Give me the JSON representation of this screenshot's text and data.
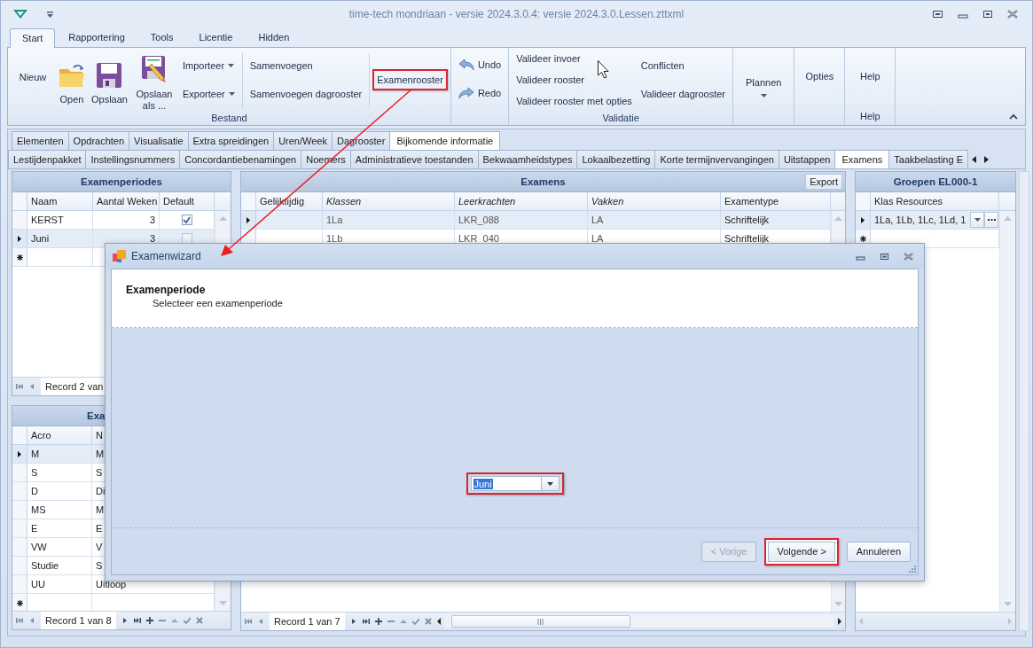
{
  "window": {
    "title": "time-tech mondriaan - versie 2024.3.0.4: versie 2024.3.0.Lessen.zttxml"
  },
  "ribbon_tabs": [
    {
      "label": "Start",
      "selected": true
    },
    {
      "label": "Rapportering",
      "selected": false
    },
    {
      "label": "Tools",
      "selected": false
    },
    {
      "label": "Licentie",
      "selected": false
    },
    {
      "label": "Hidden",
      "selected": false
    }
  ],
  "ribbon_groups": [
    {
      "label": "Bestand",
      "columns": [
        {
          "kind": "large",
          "items": [
            {
              "kind": "text",
              "label": "Nieuw",
              "highlighted": false
            }
          ]
        },
        {
          "kind": "large",
          "items": [
            {
              "kind": "folder",
              "label": "Open",
              "highlighted": false
            }
          ]
        },
        {
          "kind": "large",
          "items": [
            {
              "kind": "floppy",
              "label": "Opslaan",
              "highlighted": false
            }
          ]
        },
        {
          "kind": "large",
          "items": [
            {
              "kind": "floppyedit",
              "label": "Opslaan als ...",
              "highlighted": false
            }
          ]
        },
        {
          "kind": "small",
          "items": [
            {
              "kind": "dropdown",
              "label": "Importeer",
              "highlighted": false
            },
            {
              "kind": "dropdown",
              "label": "Exporteer",
              "highlighted": false
            }
          ]
        },
        {
          "kind": "divider"
        },
        {
          "kind": "small",
          "items": [
            {
              "kind": "plain",
              "label": "Samenvoegen",
              "highlighted": false
            },
            {
              "kind": "plain",
              "label": "Samenvoegen dagrooster",
              "highlighted": false
            }
          ]
        },
        {
          "kind": "divider"
        },
        {
          "kind": "small",
          "items": [
            {
              "kind": "plain",
              "label": "Examenrooster",
              "highlighted": true
            }
          ]
        }
      ]
    },
    {
      "columns": [
        {
          "kind": "small",
          "items": [
            {
              "kind": "undo",
              "label": "Undo",
              "highlighted": false
            },
            {
              "kind": "redo",
              "label": "Redo",
              "highlighted": false
            }
          ]
        }
      ]
    },
    {
      "label": "Validatie",
      "columns": [
        {
          "kind": "small",
          "items": [
            {
              "kind": "plain",
              "label": "Valideer invoer",
              "highlighted": false
            },
            {
              "kind": "plain",
              "label": "Valideer rooster",
              "highlighted": false
            },
            {
              "kind": "plain",
              "label": "Valideer rooster met opties",
              "highlighted": false
            }
          ]
        },
        {
          "kind": "small",
          "items": [
            {
              "kind": "plain",
              "label": "Conflicten",
              "highlighted": false
            },
            {
              "kind": "plain",
              "label": "Valideer dagrooster",
              "highlighted": false
            }
          ]
        }
      ]
    },
    {
      "columns": [
        {
          "kind": "large",
          "items": [
            {
              "kind": "menu",
              "label": "Plannen",
              "highlighted": false
            }
          ]
        }
      ]
    },
    {
      "columns": [
        {
          "kind": "large",
          "items": [
            {
              "kind": "text",
              "label": "Opties",
              "highlighted": false
            }
          ]
        }
      ]
    },
    {
      "label": "Help",
      "columns": [
        {
          "kind": "large",
          "items": [
            {
              "kind": "text",
              "label": "Help",
              "highlighted": false
            }
          ]
        }
      ]
    }
  ],
  "tabs_top": [
    {
      "label": "Elementen",
      "selected": false
    },
    {
      "label": "Opdrachten",
      "selected": false
    },
    {
      "label": "Visualisatie",
      "selected": false
    },
    {
      "label": "Extra spreidingen",
      "selected": false
    },
    {
      "label": "Uren/Week",
      "selected": false
    },
    {
      "label": "Dagrooster",
      "selected": false
    },
    {
      "label": "Bijkomende informatie",
      "selected": true
    }
  ],
  "tabs_sub": [
    {
      "label": "Lestijdenpakket",
      "selected": false
    },
    {
      "label": "Instellingsnummers",
      "selected": false
    },
    {
      "label": "Concordantiebenamingen",
      "selected": false
    },
    {
      "label": "Noemers",
      "selected": false
    },
    {
      "label": "Administratieve toestanden",
      "selected": false
    },
    {
      "label": "Bekwaamheidstypes",
      "selected": false
    },
    {
      "label": "Lokaalbezetting",
      "selected": false
    },
    {
      "label": "Korte termijnvervangingen",
      "selected": false
    },
    {
      "label": "Uitstappen",
      "selected": false
    },
    {
      "label": "Examens",
      "selected": true
    },
    {
      "label": "Taakbelasting E",
      "selected": false
    }
  ],
  "panels": [
    {
      "title": "Examenperiodes",
      "columns": [
        {
          "label": "Naam",
          "kind": "text"
        },
        {
          "label": "Aantal Weken",
          "kind": "number"
        },
        {
          "label": "Default",
          "kind": "check"
        }
      ],
      "rows": [
        {
          "selected": false,
          "cells": [
            "KERST",
            "3",
            true
          ]
        },
        {
          "selected": true,
          "cells": [
            "Juni",
            "3",
            false
          ]
        }
      ],
      "record": "Record 2 van"
    },
    {
      "title": "Exa",
      "columns": [
        {
          "label": "Acro",
          "kind": "text"
        },
        {
          "label": "N",
          "kind": "text"
        }
      ],
      "rows": [
        {
          "selected": true,
          "cells": [
            "M",
            "M"
          ]
        },
        {
          "selected": false,
          "cells": [
            "S",
            "S"
          ]
        },
        {
          "selected": false,
          "cells": [
            "D",
            "Di"
          ]
        },
        {
          "selected": false,
          "cells": [
            "MS",
            "M"
          ]
        },
        {
          "selected": false,
          "cells": [
            "E",
            "E"
          ]
        },
        {
          "selected": false,
          "cells": [
            "VW",
            "V"
          ]
        },
        {
          "selected": false,
          "cells": [
            "Studie",
            "S"
          ]
        },
        {
          "selected": false,
          "cells": [
            "UU",
            "Uitloop"
          ]
        }
      ],
      "record": "Record 1 van 8"
    },
    {
      "title": "Examens",
      "action": "Export",
      "columns": [
        {
          "label": "Gelijktijdig",
          "kind": "text",
          "italic": false
        },
        {
          "label": "Klassen",
          "kind": "text",
          "italic": true
        },
        {
          "label": "Leerkrachten",
          "kind": "text",
          "italic": true
        },
        {
          "label": "Vakken",
          "kind": "text",
          "italic": true
        },
        {
          "label": "Examentype",
          "kind": "text",
          "italic": false
        }
      ],
      "rows": [
        {
          "selected": true,
          "cells": [
            null,
            "1La",
            "LKR_088",
            "LA",
            "Schriftelijk"
          ]
        },
        {
          "selected": false,
          "cells": [
            null,
            "1Lb",
            "LKR_040",
            "LA",
            "Schriftelijk"
          ]
        }
      ],
      "record": "Record 1 van 7"
    },
    {
      "title": "Groepen EL000-1",
      "columns": [
        {
          "label": "Klas Resources",
          "kind": "combo"
        }
      ],
      "rows": [
        {
          "selected": true,
          "cells": [
            "1La, 1Lb, 1Lc, 1Ld, 1"
          ]
        }
      ]
    }
  ],
  "dialog": {
    "title": "Examenwizard",
    "heading": "Examenperiode",
    "subheading": "Selecteer een examenperiode",
    "period_field": {
      "value": "Juni",
      "highlighted": true
    },
    "buttons": [
      {
        "label": "< Vorige",
        "disabled": true,
        "highlighted": false
      },
      {
        "label": "Volgende >",
        "disabled": false,
        "highlighted": true
      },
      {
        "label": "Annuleren",
        "disabled": false,
        "highlighted": false
      }
    ]
  }
}
